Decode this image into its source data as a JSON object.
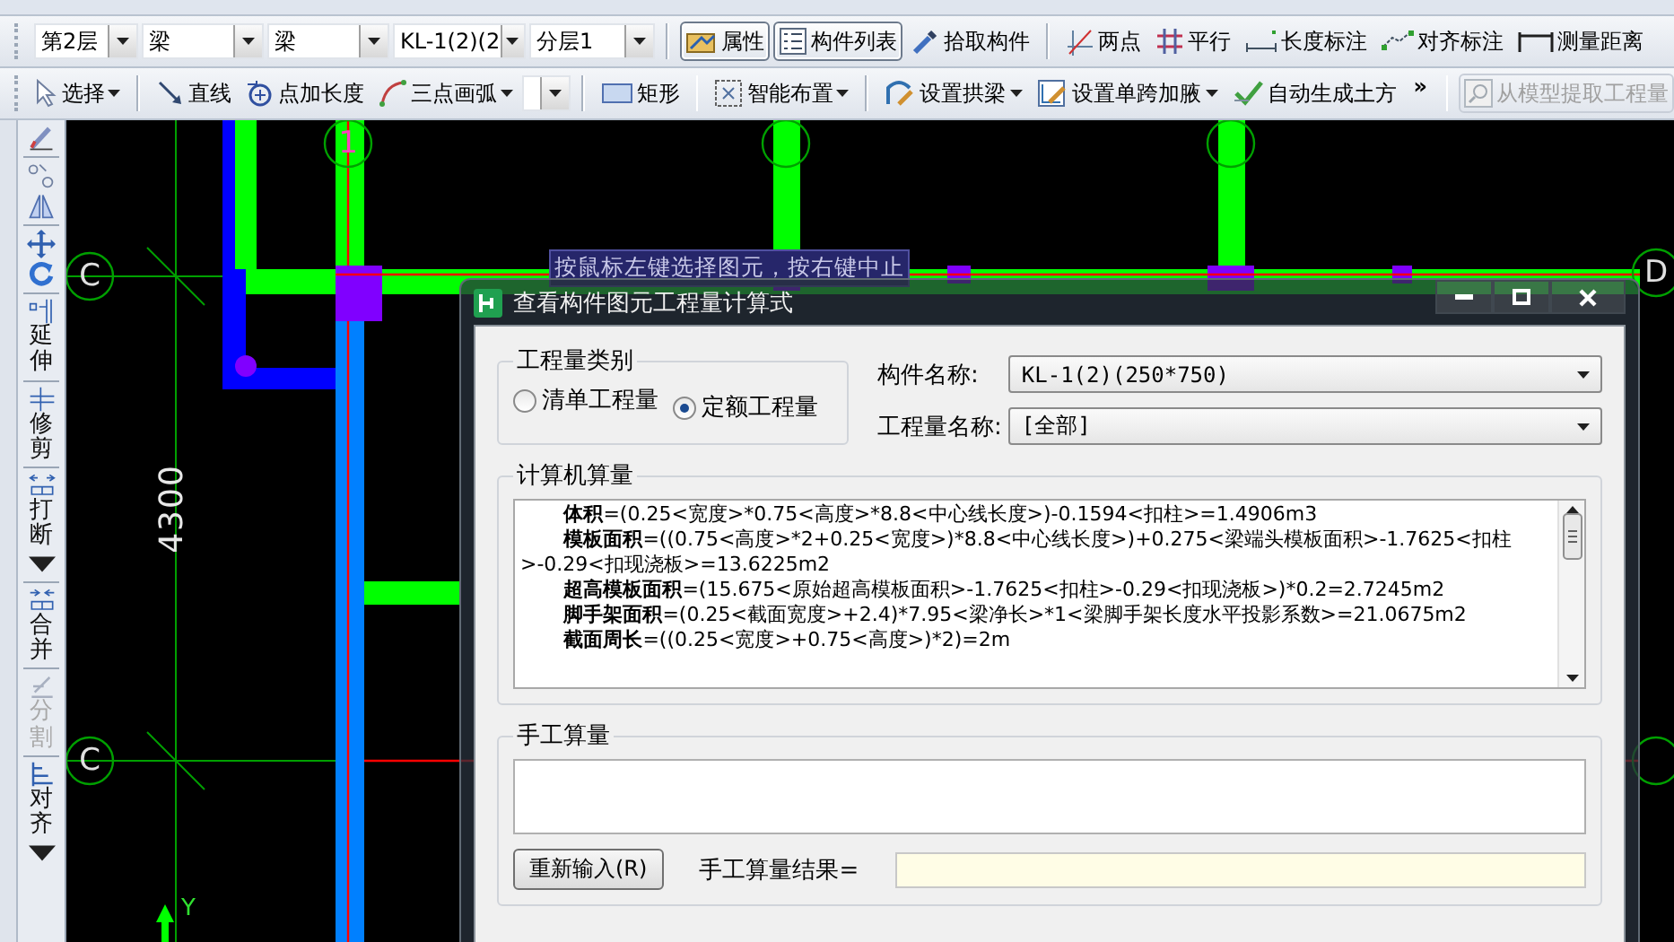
{
  "toolbar_main": [
    {
      "kind": "combo",
      "value": "第2层"
    },
    {
      "kind": "combo",
      "value": "梁"
    },
    {
      "kind": "combo",
      "value": "梁"
    },
    {
      "kind": "combo",
      "value": "KL-1(2)(2"
    },
    {
      "kind": "combo",
      "value": "分层1"
    },
    {
      "kind": "button",
      "label": "属性",
      "selected": true
    },
    {
      "kind": "button",
      "label": "构件列表",
      "selected": true
    },
    {
      "kind": "button",
      "label": "拾取构件",
      "selected": false
    },
    {
      "kind": "button",
      "label": "两点",
      "selected": false
    },
    {
      "kind": "button",
      "label": "平行",
      "selected": false
    },
    {
      "kind": "button",
      "label": "长度标注",
      "selected": false
    },
    {
      "kind": "button",
      "label": "对齐标注",
      "selected": false
    },
    {
      "kind": "button",
      "label": "测量距离",
      "selected": false
    }
  ],
  "toolbar_draw": [
    {
      "kind": "button",
      "label": "选择",
      "dropdown": true,
      "disabled": false
    },
    {
      "kind": "button",
      "label": "直线",
      "dropdown": false,
      "disabled": false
    },
    {
      "kind": "button",
      "label": "点加长度",
      "dropdown": false,
      "disabled": false
    },
    {
      "kind": "button",
      "label": "三点画弧",
      "dropdown": true,
      "disabled": false
    },
    {
      "kind": "combo"
    },
    {
      "kind": "button",
      "label": "矩形",
      "dropdown": false,
      "disabled": false
    },
    {
      "kind": "button",
      "label": "智能布置",
      "dropdown": true,
      "disabled": false
    },
    {
      "kind": "button",
      "label": "设置拱梁",
      "dropdown": true,
      "disabled": false
    },
    {
      "kind": "button",
      "label": "设置单跨加腋",
      "dropdown": true,
      "disabled": false
    },
    {
      "kind": "button",
      "label": "自动生成土方",
      "dropdown": false,
      "disabled": false
    },
    {
      "kind": "overflow",
      "label": "»"
    },
    {
      "kind": "button",
      "label": "从模型提取工程量",
      "dropdown": false,
      "disabled": true
    }
  ],
  "edit_toolbar": {
    "tools": [
      {
        "label": "延伸",
        "dropdown": false,
        "disabled": false
      },
      {
        "label": "修剪",
        "dropdown": false,
        "disabled": false
      },
      {
        "label": "打断",
        "dropdown": true,
        "disabled": false
      },
      {
        "label": "合并",
        "dropdown": false,
        "disabled": false
      },
      {
        "label": "分割",
        "dropdown": false,
        "disabled": true
      },
      {
        "label": "对齐",
        "dropdown": true,
        "disabled": false
      }
    ]
  },
  "canvas": {
    "axis_labels": [
      "C",
      "C",
      "1",
      "D"
    ],
    "dimension": "4300",
    "y_axis_label": "Y",
    "tooltip": "按鼠标左键选择图元，按右键中止"
  },
  "dialog": {
    "title": "查看构件图元工程量计算式",
    "quantity_type": {
      "legend": "工程量类别",
      "options": [
        {
          "label": "清单工程量",
          "selected": false
        },
        {
          "label": "定额工程量",
          "selected": true
        }
      ]
    },
    "component_name": {
      "label": "构件名称:",
      "value": "KL-1(2)(250*750)"
    },
    "quantity_name": {
      "label": "工程量名称:",
      "value": "[全部]"
    },
    "computed": {
      "legend": "计算机算量",
      "lines": [
        "**体积**=(0.25<宽度>*0.75<高度>*8.8<中心线长度>)-0.1594<扣柱>=1.4906m3",
        "**模板面积**=((0.75<高度>*2+0.25<宽度>)*8.8<中心线长度>)+0.275<梁端头模板面积>-1.7625<扣柱>-0.29<扣现浇板>=13.6225m2",
        "**超高模板面积**=(15.675<原始超高模板面积>-1.7625<扣柱>-0.29<扣现浇板>)*0.2=2.7245m2",
        "**脚手架面积**=(0.25<截面宽度>+2.4)*7.95<梁净长>*1<梁脚手架长度水平投影系数>=21.0675m2",
        "**截面周长**=((0.25<宽度>+0.75<高度>)*2)=2m"
      ]
    },
    "manual": {
      "legend": "手工算量",
      "reset_button": "重新输入(R)",
      "result_label": "手工算量结果="
    }
  }
}
